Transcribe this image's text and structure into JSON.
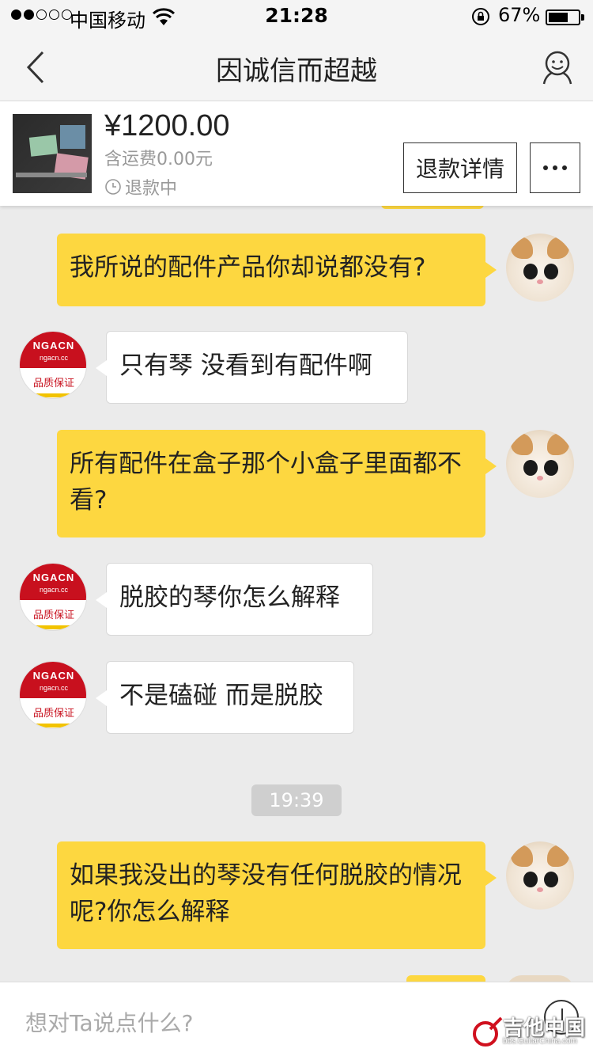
{
  "status_bar": {
    "carrier": "中国移动",
    "time": "21:28",
    "battery_percent": "67%",
    "battery_level": 0.67
  },
  "nav": {
    "title": "因诚信而超越"
  },
  "order": {
    "price": "¥1200.00",
    "shipping": "含运费0.00元",
    "status": "退款中",
    "refund_button": "退款详情"
  },
  "messages": [
    {
      "from": "me",
      "text": "我所说的配件产品你却说都没有?"
    },
    {
      "from": "shop",
      "text": "只有琴 没看到有配件啊"
    },
    {
      "from": "me",
      "text": "所有配件在盒子那个小盒子里面都不看?"
    },
    {
      "from": "shop",
      "text": "脱胶的琴你怎么解释"
    },
    {
      "from": "shop",
      "text": "不是磕碰 而是脱胶"
    },
    {
      "from": "me",
      "text": "如果我没出的琴没有任何脱胶的情况呢?你怎么解释"
    }
  ],
  "timestamp": "19:39",
  "shop_avatar": {
    "name": "NGACN",
    "url": "ngacn.cc",
    "tag": "品质保证"
  },
  "input": {
    "placeholder": "想对Ta说点什么?"
  },
  "watermark": {
    "text": "吉他中国",
    "url": "bbs.GuitarChina.com"
  },
  "colors": {
    "my_bubble": "#fdd740",
    "their_bubble": "#ffffff",
    "background": "#ebebeb",
    "shop_red": "#c8101e"
  }
}
